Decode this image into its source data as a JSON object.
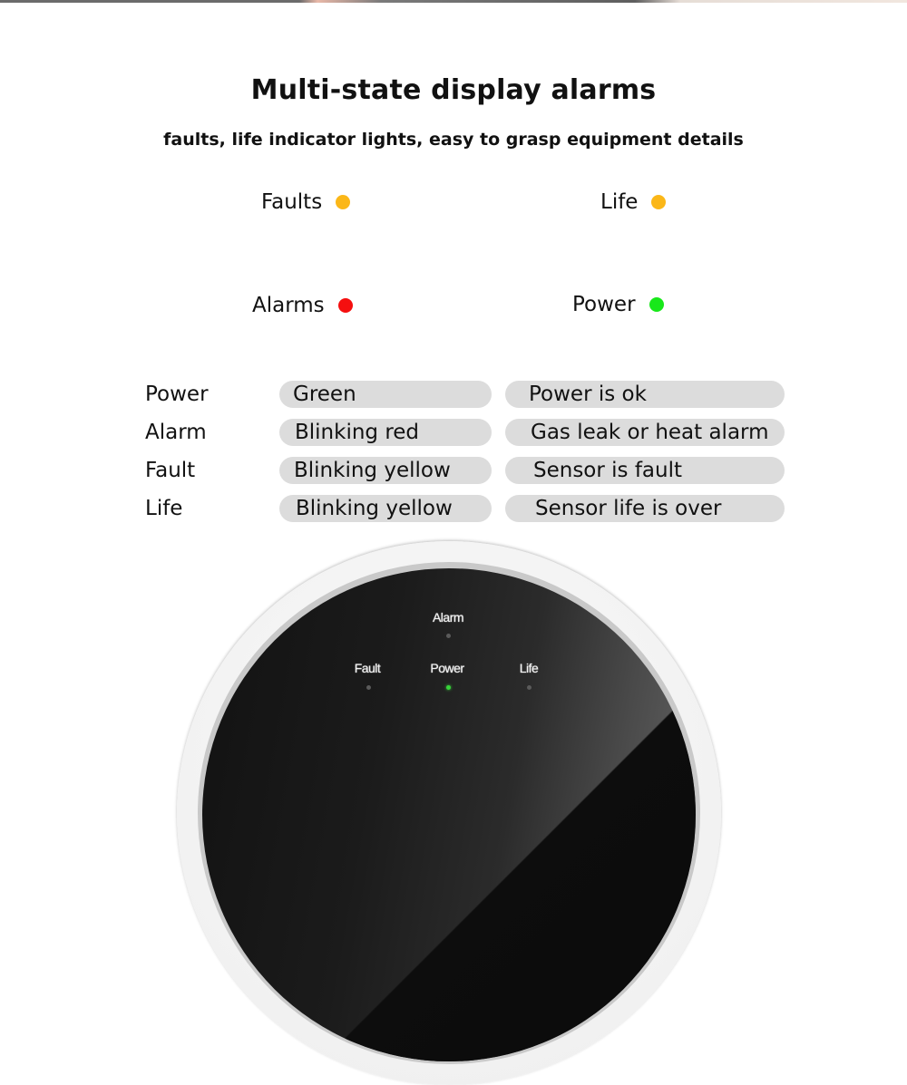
{
  "header": {
    "title": "Multi-state display alarms",
    "subtitle": "faults, life indicator lights, easy to grasp equipment details"
  },
  "legend": [
    {
      "label": "Faults",
      "color": "#FBB718"
    },
    {
      "label": "Life",
      "color": "#FBB718"
    },
    {
      "label": "Alarms",
      "color": "#F50F0F"
    },
    {
      "label": "Power",
      "color": "#18E81A"
    }
  ],
  "status_table": {
    "rows": [
      {
        "indicator": "Power",
        "state": "Green",
        "meaning": "Power is ok"
      },
      {
        "indicator": "Alarm",
        "state": "Blinking red",
        "meaning": "Gas leak or heat alarm"
      },
      {
        "indicator": "Fault",
        "state": "Blinking yellow",
        "meaning": "Sensor is fault"
      },
      {
        "indicator": "Life",
        "state": "Blinking yellow",
        "meaning": "Sensor life is over"
      }
    ]
  },
  "device": {
    "indicators": [
      {
        "label": "Alarm",
        "lit": false
      },
      {
        "label": "Fault",
        "lit": false
      },
      {
        "label": "Power",
        "lit": true,
        "color": "#37D43A"
      },
      {
        "label": "Life",
        "lit": false
      }
    ]
  }
}
